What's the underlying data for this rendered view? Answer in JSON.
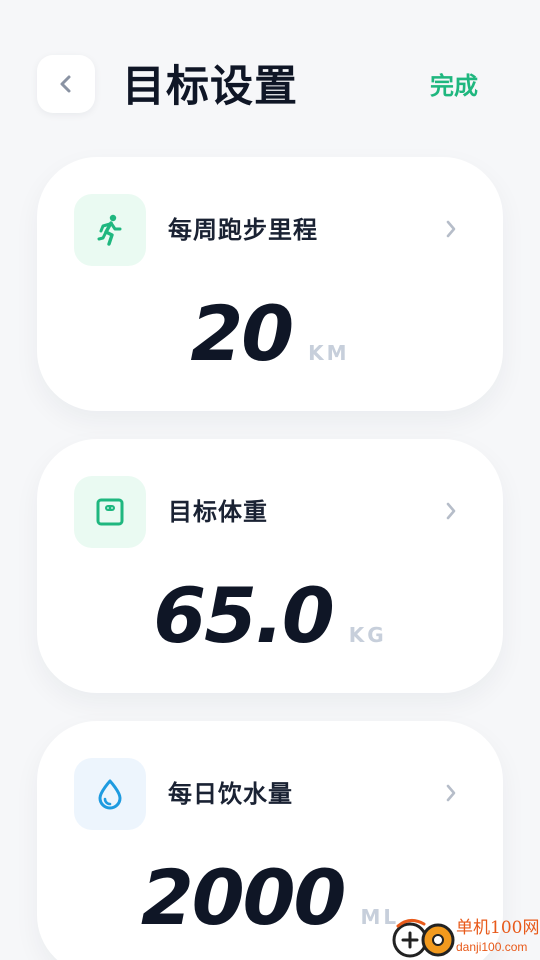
{
  "header": {
    "back_icon": "chevron-left-icon",
    "title": "目标设置",
    "done_label": "完成"
  },
  "cards": [
    {
      "icon": "running-icon",
      "label": "每周跑步里程",
      "value": "20",
      "unit": "KM"
    },
    {
      "icon": "scale-icon",
      "label": "目标体重",
      "value": "65.0",
      "unit": "KG"
    },
    {
      "icon": "water-drop-icon",
      "label": "每日饮水量",
      "value": "2000",
      "unit": "ML"
    }
  ],
  "watermark": {
    "cn": "单机100网",
    "en": "danji100.com"
  },
  "colors": {
    "accent": "#1fb77f",
    "title": "#0f1626",
    "unit": "#c7cfdb",
    "water": "#1e9be0",
    "background": "#f6f7f9"
  }
}
